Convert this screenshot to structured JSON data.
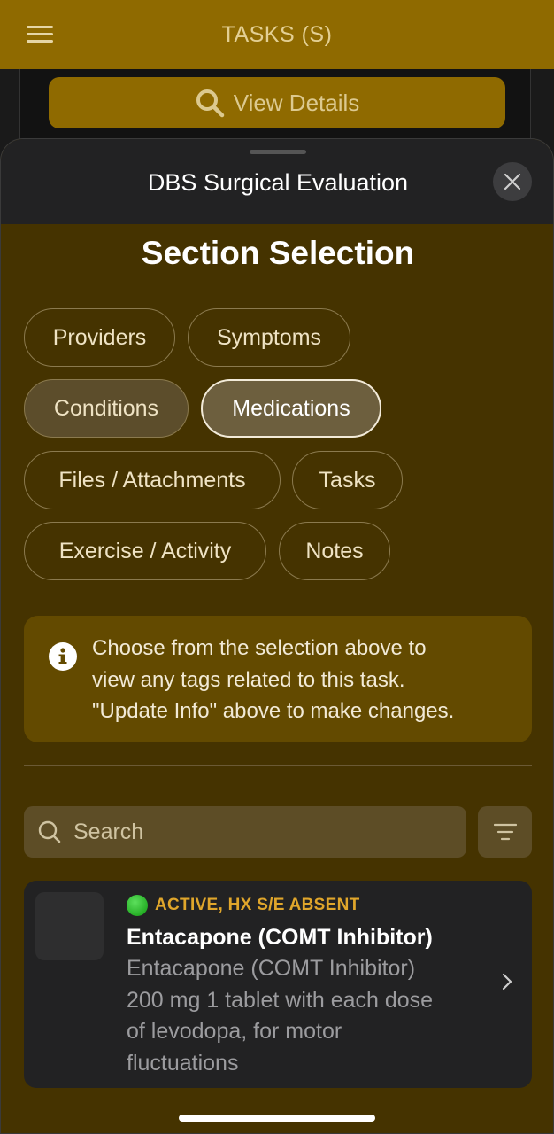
{
  "top_bar": {
    "title": "TASKS (S)",
    "menu_icon": "hamburger-menu-icon"
  },
  "behind": {
    "view_details_label": "View Details",
    "view_details_icon": "search-icon"
  },
  "sheet": {
    "title": "DBS Surgical Evaluation",
    "close_icon": "close-icon",
    "section_title": "Section Selection",
    "chips": [
      {
        "label": "Providers",
        "state": "default"
      },
      {
        "label": "Symptoms",
        "state": "default"
      },
      {
        "label": "Conditions",
        "state": "tinted"
      },
      {
        "label": "Medications",
        "state": "selected"
      },
      {
        "label": "Files / Attachments",
        "state": "default"
      },
      {
        "label": "Tasks",
        "state": "default"
      },
      {
        "label": "Exercise / Activity",
        "state": "default"
      },
      {
        "label": "Notes",
        "state": "default"
      }
    ],
    "info": {
      "icon": "info-icon",
      "line1": "Choose from the selection above to",
      "line2": "view any tags related to this task.",
      "line3": "\"Update Info\" above to make changes."
    },
    "search": {
      "placeholder": "Search",
      "value": "",
      "filter_icon": "filter-icon"
    },
    "medication": {
      "status": "ACTIVE, HX S/E ABSENT",
      "status_color": "#21b921",
      "name": "Entacapone (COMT Inhibitor)",
      "desc_line1": "Entacapone (COMT Inhibitor)",
      "desc_line2": "200 mg 1 tablet with each dose",
      "desc_line3": "of levodopa, for motor",
      "desc_line4": "fluctuations"
    }
  },
  "colors": {
    "accent_gold": "#8f6a00",
    "sheet_bg": "#453300",
    "status_amber": "#e0a62b"
  }
}
